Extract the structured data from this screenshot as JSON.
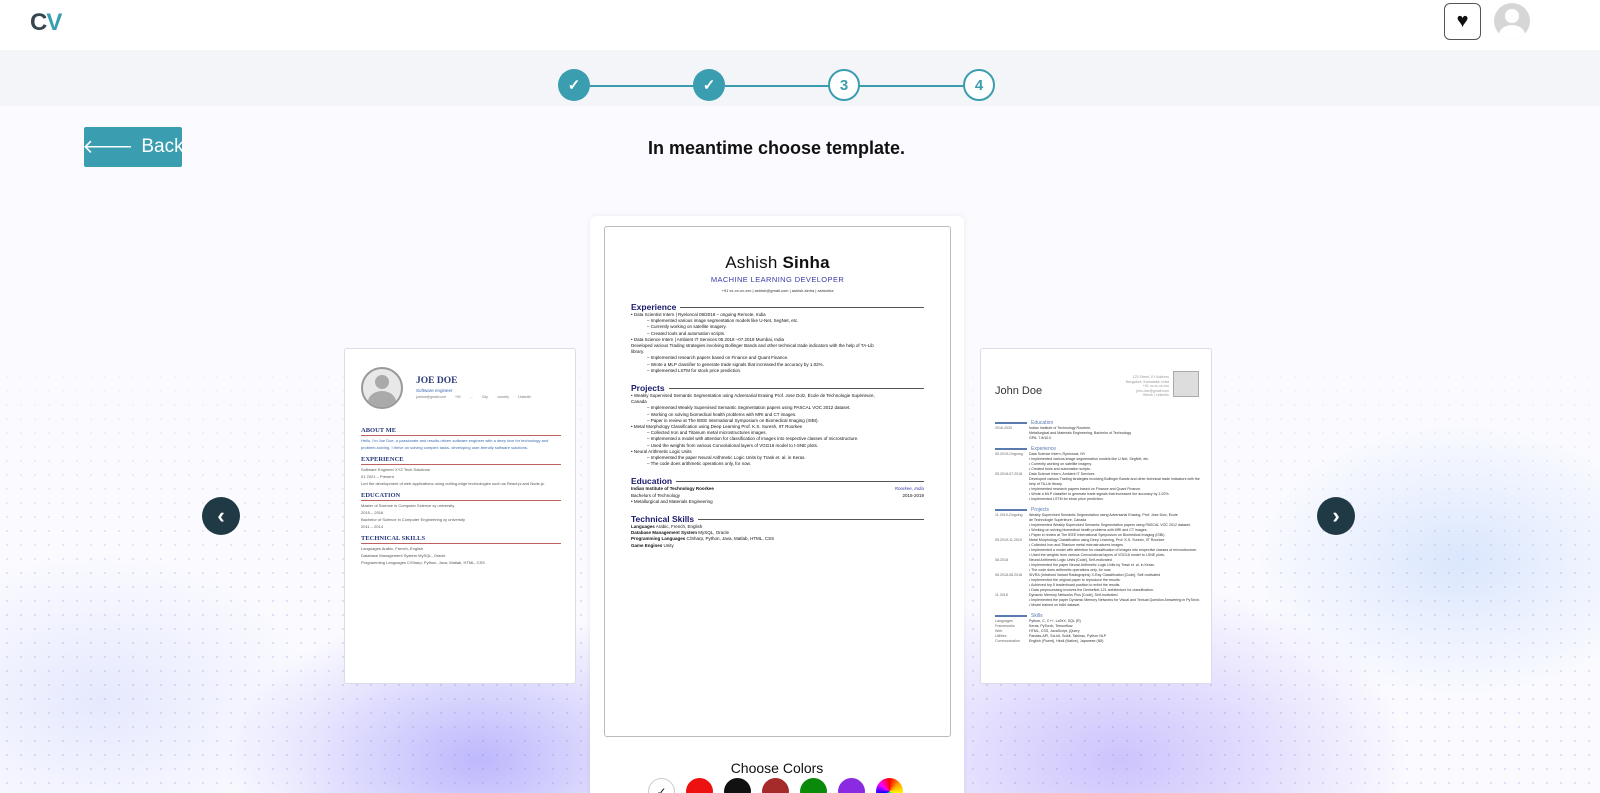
{
  "header": {
    "logo_c": "C",
    "logo_v": "V",
    "favorite_icon": "heart-icon",
    "avatar_icon": "user-avatar-icon"
  },
  "stepper": {
    "steps": [
      {
        "label": "✓",
        "state": "done"
      },
      {
        "label": "✓",
        "state": "done"
      },
      {
        "label": "3",
        "state": "todo"
      },
      {
        "label": "4",
        "state": "todo"
      }
    ],
    "accent": "#3a9db0"
  },
  "back_button": {
    "label": "Back",
    "icon": "arrow-left-icon"
  },
  "heading": "In meantime choose template.",
  "carousel": {
    "prev_icon": "chevron-left-icon",
    "next_icon": "chevron-right-icon"
  },
  "template_left": {
    "name": "JOE DOE",
    "title": "Software engineer",
    "meta": "joedoe@gmail.com  +91 ...  City, country  LinkedIn",
    "sections": [
      {
        "title": "ABOUT ME",
        "lines": [
          "Hello, I'm Joe Doe, a passionate and results-driven software engineer with a deep love for technology and",
          "problem-solving. I thrive on solving complex tasks, developing user-friendly software solutions."
        ]
      },
      {
        "title": "EXPERIENCE",
        "lines": [
          "Software Engineer XYZ Tech Solutions",
          "01 2021 – Present",
          "Led the development of web applications using cutting-edge technologies such as React.js and Node.js."
        ]
      },
      {
        "title": "EDUCATION",
        "lines": [
          "Master of Science in Computer Science  xy university",
          "2015 – 2016",
          "Bachelor of Science in Computer Engineering  xy university",
          "2011 – 2014"
        ]
      },
      {
        "title": "TECHNICAL SKILLS",
        "lines": [
          "Languages Arabic, French, English",
          "Database Management System MySQL, Oracle",
          "Programming Languages C/Sharp, Python, Java, Matlab, HTML, CSS"
        ]
      }
    ]
  },
  "template_center": {
    "first_name": "Ashish",
    "last_name": "Sinha",
    "role": "MACHINE LEARNING DEVELOPER",
    "contact": "+91 xx-xx-xx-xxx  |  ashish@gmail.com  |  ashish-sinha  |  ashsinha",
    "sections": {
      "experience": {
        "title": "Experience",
        "lines": [
          {
            "t": "• Data Scientist Intern | Ryeloncal 08/2018 – ongoing Remote, India",
            "i": false
          },
          {
            "t": "– Implemented various image segmentation models like U-Net, SegNet, etc.",
            "i": true
          },
          {
            "t": "– Currently working on satellite imagery.",
            "i": true
          },
          {
            "t": "– Created tools and automation scripts.",
            "i": true
          },
          {
            "t": "• Data Science Intern | Ambient IT Services 05.2018 –07.2018 Mumbai, India",
            "i": false
          },
          {
            "t": "Developed various Trading strategies involving Bollinger Bands and other technical trade indicators with the help of TA-Lib",
            "i": false
          },
          {
            "t": "library.",
            "i": false
          },
          {
            "t": "– Implemented research papers based on Finance and Quant Finance.",
            "i": true
          },
          {
            "t": "– Wrote a MLP classifier to generate trade signals that increased the accuracy by 1.02%.",
            "i": true
          },
          {
            "t": "– Implemented LSTM for stock price prediction.",
            "i": true
          }
        ]
      },
      "projects": {
        "title": "Projects",
        "lines": [
          {
            "t": "• Weakly Supervised Semantic Segmentation using Adversarial Erasing  Prof. Jose Dolz, École de Technologie Supérieure,",
            "i": false
          },
          {
            "t": "Canada",
            "i": false
          },
          {
            "t": "– Implemented Weakly Supervised Semantic Segmentation papers using PASCAL VOC 2012 dataset.",
            "i": true
          },
          {
            "t": "– Working on solving biomedical health problems with MRI and CT images.",
            "i": true
          },
          {
            "t": "– Paper in review at The IEEE International Symposium on Biomedical Imaging (ISBI).",
            "i": true
          },
          {
            "t": "• Metal Morphology Classification using Deep Learning Prof. K.S. Suresh, IIT Roorkee",
            "i": false
          },
          {
            "t": "– Collected Iron and Titanium metal microstructures images.",
            "i": true
          },
          {
            "t": "– Implemented a model with attention for classification of images into respective classes of microstructure.",
            "i": true
          },
          {
            "t": "– Used the weights from various Convolutional layers of VGG16 model to t-SNE plots.",
            "i": true
          },
          {
            "t": "• Neural Arithmetic Logic Units",
            "i": false
          },
          {
            "t": "– Implemented the paper Neural Arithmetic Logic Units by Trask et. al. in Keras.",
            "i": true
          },
          {
            "t": "– The code does arithmetic operations only, for now.",
            "i": true
          }
        ]
      },
      "education": {
        "title": "Education",
        "school": "Indian Institute of Technology Roorkee",
        "location": "Roorkee, India",
        "degree": "Bachelors of Technology",
        "dates": "2015-2019",
        "major": "• Metallurgical and Materials Engineering"
      },
      "skills": {
        "title": "Technical Skills",
        "lines": [
          {
            "k": "Languages",
            "v": "Arabic, French, English"
          },
          {
            "k": "Database Management System",
            "v": "MySQL, Oracle"
          },
          {
            "k": "Programming Languages",
            "v": "C/Sharp, Python, Java, Matlab, HTML, CSS"
          },
          {
            "k": "Game Engines",
            "v": "Unity"
          }
        ]
      }
    }
  },
  "template_right": {
    "name": "John Doe",
    "address": [
      "123 Street, XY Address",
      "Bangalore, Karnataka, India",
      "+91 xx-xx-xx-xxx",
      "john.doe@gmail.com",
      "Github | LinkedIn"
    ],
    "sections": [
      {
        "title": "Education",
        "lines": [
          [
            "2016-2020",
            "Indian Institute of Technology Roorkee,"
          ],
          [
            "",
            "Metallurgical and Materials Engineering, Bachelor of Technology"
          ],
          [
            "",
            "GPA: 7.8/10.0"
          ]
        ]
      },
      {
        "title": "Experience",
        "lines": [
          [
            "05.2019-Ongoing",
            "Data Science Intern, Ryeloncal, NY"
          ],
          [
            "",
            "• Implemented various image segmentation models like U-Net, SegNet, etc."
          ],
          [
            "",
            "• Currently working on satellite imagery."
          ],
          [
            "",
            "• Created tools and automation scripts."
          ],
          [
            "05.2018-07.2018",
            "Data Science Intern, Ambient IT Services"
          ],
          [
            "",
            "Developed various Trading strategies involving Bollinger Bands and other technical trade indicators with the"
          ],
          [
            "",
            "help of TA-Lib library."
          ],
          [
            "",
            "• Implemented research papers based on Finance and Quant Finance."
          ],
          [
            "",
            "• Wrote a MLP classifier to generate trade signals that increased the accuracy by 1.02%."
          ],
          [
            "",
            "• Implemented LSTM for stock price prediction."
          ]
        ]
      },
      {
        "title": "Projects",
        "lines": [
          [
            "11.2019-Ongoing",
            "Weakly Supervised Semantic Segmentation using Adversarial Erasing, Prof. Jose Dolz, École"
          ],
          [
            "",
            "de Technologie Supérieure, Canada"
          ],
          [
            "",
            "• Implemented Weakly Supervised Semantic Segmentation papers using PASCAL VOC 2012 dataset."
          ],
          [
            "",
            "• Working on solving biomedical health problems with MRI and CT images."
          ],
          [
            "",
            "• Paper in review at The IEEE International Symposium on Biomedical Imaging (ISBI)."
          ],
          [
            "05.2019-11.2019",
            "Metal Morphology Classification using Deep Learning, Prof. K.S. Suresh, IIT Roorkee"
          ],
          [
            "",
            "• Collected Iron and Titanium metal microstructures images."
          ],
          [
            "",
            "• Implemented a model with attention for classification of images into respective classes of microstructure."
          ],
          [
            "",
            "• Used the weights from various Convolutional layers of VGG16 model to t-SNE plots."
          ],
          [
            "08.2018",
            "Neural Arithmetic Logic Units [Code], Self-motivated"
          ],
          [
            "",
            "• Implemented the paper Neural Arithmetic Logic Units by Trask et. al. in Keras."
          ],
          [
            "",
            "• The code does arithmetic operations only, for now."
          ],
          [
            "06.2018-08.2018",
            "SIVRA (Intrahost Variant Radiographs) X-Ray Classification [Code], Self-motivated"
          ],
          [
            "",
            "• Implemented the original paper to reproduce the results."
          ],
          [
            "",
            "• Achieved top 5 leaderboard position to enlist the results."
          ],
          [
            "",
            "• Data preprocessing involves the DenseNet-121 architecture for classification."
          ],
          [
            "11.2018",
            "Dynamic Memory Networks Plus [Code], Self-motivated"
          ],
          [
            "",
            "• Implemented the paper Dynamic Memory Networks for Visual and Textual Question Answering in PyTorch."
          ],
          [
            "",
            "• Model trained on bAbI dataset."
          ]
        ]
      },
      {
        "title": "Skills",
        "lines": [
          [
            "Languages",
            "Python, C, C++, LaTeX, SQL (R)"
          ],
          [
            "Frameworks",
            "Keras, PyTorch, Tensorflow"
          ],
          [
            "Web",
            "HTML, CSS, JavaScript, jQuery"
          ],
          [
            "Utilities",
            "Pandas-API, Sci-kit, Scikit, Tableau, Python NLP"
          ],
          [
            "Communication",
            "English (Fluent), Hindi (Native), Japanese (N5)"
          ]
        ]
      }
    ]
  },
  "choose_colors": {
    "label": "Choose Colors",
    "swatches": [
      {
        "name": "white",
        "color": "#ffffff",
        "selected": true
      },
      {
        "name": "red",
        "color": "#ee1111",
        "selected": false
      },
      {
        "name": "black",
        "color": "#111111",
        "selected": false
      },
      {
        "name": "dark-red",
        "color": "#a52a2a",
        "selected": false
      },
      {
        "name": "green",
        "color": "#0a8a0a",
        "selected": false
      },
      {
        "name": "purple",
        "color": "#8a2be2",
        "selected": false
      },
      {
        "name": "rainbow",
        "color": "rainbow",
        "selected": false
      }
    ]
  }
}
